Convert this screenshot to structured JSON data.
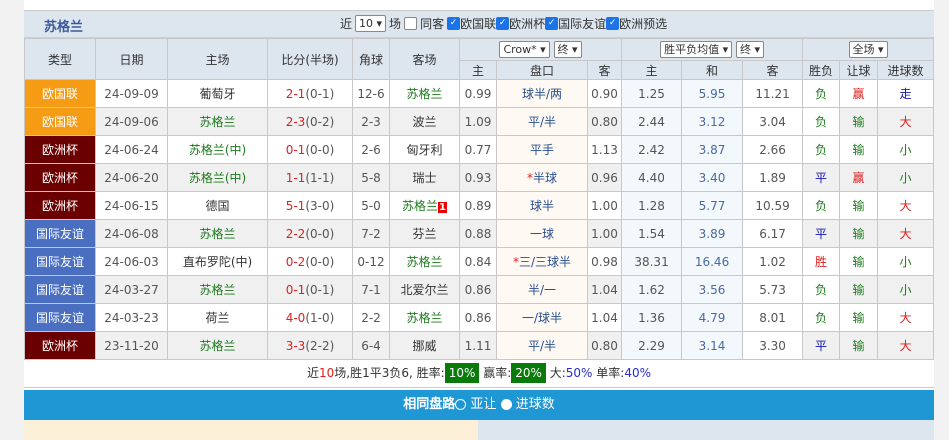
{
  "team": "苏格兰",
  "filters": {
    "near": "近",
    "count": "10",
    "unit": "场",
    "same_away": "同客",
    "same_away_checked": false,
    "leagues": [
      {
        "label": "欧国联",
        "checked": true
      },
      {
        "label": "欧洲杯",
        "checked": true
      },
      {
        "label": "国际友谊",
        "checked": true
      },
      {
        "label": "欧洲预选",
        "checked": true
      }
    ]
  },
  "headers": {
    "type": "类型",
    "date": "日期",
    "home": "主场",
    "score": "比分(半场)",
    "corner": "角球",
    "away": "客场",
    "company": "Crow*",
    "phase1": "终",
    "odds_type": "胜平负均值",
    "phase2": "终",
    "scope": "全场",
    "ah_home": "主",
    "ah_line": "盘口",
    "ah_away": "客",
    "eu_home": "主",
    "eu_draw": "和",
    "eu_away": "客",
    "wl": "胜负",
    "ah_res": "让球",
    "ou_res": "进球数"
  },
  "colors": {
    "欧国联": "#f59b14",
    "欧洲杯": "#6b0000",
    "国际友谊": "#4a6fc1"
  },
  "rows": [
    {
      "type": "欧国联",
      "date": "24-09-09",
      "home": "葡萄牙",
      "home_green": false,
      "ft": "2-1",
      "ht": "(0-1)",
      "corner": "12-6",
      "away": "苏格兰",
      "away_green": true,
      "red_card": "",
      "ah1": "0.99",
      "line": "球半/两",
      "star": "",
      "ah2": "0.90",
      "e1": "1.25",
      "e2": "5.95",
      "e3": "11.21",
      "wl": "负",
      "ah": "赢",
      "ou": "走"
    },
    {
      "type": "欧国联",
      "date": "24-09-06",
      "home": "苏格兰",
      "home_green": true,
      "ft": "2-3",
      "ht": "(0-2)",
      "corner": "2-3",
      "away": "波兰",
      "away_green": false,
      "red_card": "",
      "ah1": "1.09",
      "line": "平/半",
      "star": "",
      "ah2": "0.80",
      "e1": "2.44",
      "e2": "3.12",
      "e3": "3.04",
      "wl": "负",
      "ah": "输",
      "ou": "大"
    },
    {
      "type": "欧洲杯",
      "date": "24-06-24",
      "home": "苏格兰(中)",
      "home_green": true,
      "ft": "0-1",
      "ht": "(0-0)",
      "corner": "2-6",
      "away": "匈牙利",
      "away_green": false,
      "red_card": "",
      "ah1": "0.77",
      "line": "平手",
      "star": "",
      "ah2": "1.13",
      "e1": "2.42",
      "e2": "3.87",
      "e3": "2.66",
      "wl": "负",
      "ah": "输",
      "ou": "小"
    },
    {
      "type": "欧洲杯",
      "date": "24-06-20",
      "home": "苏格兰(中)",
      "home_green": true,
      "ft": "1-1",
      "ht": "(1-1)",
      "corner": "5-8",
      "away": "瑞士",
      "away_green": false,
      "red_card": "",
      "ah1": "0.93",
      "line": "半球",
      "star": "*",
      "ah2": "0.96",
      "e1": "4.40",
      "e2": "3.40",
      "e3": "1.89",
      "wl": "平",
      "ah": "赢",
      "ou": "小"
    },
    {
      "type": "欧洲杯",
      "date": "24-06-15",
      "home": "德国",
      "home_green": false,
      "ft": "5-1",
      "ht": "(3-0)",
      "corner": "5-0",
      "away": "苏格兰",
      "away_green": true,
      "red_card": "1",
      "ah1": "0.89",
      "line": "球半",
      "star": "",
      "ah2": "1.00",
      "e1": "1.28",
      "e2": "5.77",
      "e3": "10.59",
      "wl": "负",
      "ah": "输",
      "ou": "大"
    },
    {
      "type": "国际友谊",
      "date": "24-06-08",
      "home": "苏格兰",
      "home_green": true,
      "ft": "2-2",
      "ht": "(0-0)",
      "corner": "7-2",
      "away": "芬兰",
      "away_green": false,
      "red_card": "",
      "ah1": "0.88",
      "line": "一球",
      "star": "",
      "ah2": "1.00",
      "e1": "1.54",
      "e2": "3.89",
      "e3": "6.17",
      "wl": "平",
      "ah": "输",
      "ou": "大"
    },
    {
      "type": "国际友谊",
      "date": "24-06-03",
      "home": "直布罗陀(中)",
      "home_green": false,
      "ft": "0-2",
      "ht": "(0-0)",
      "corner": "0-12",
      "away": "苏格兰",
      "away_green": true,
      "red_card": "",
      "ah1": "0.84",
      "line": "三/三球半",
      "star": "*",
      "ah2": "0.98",
      "e1": "38.31",
      "e2": "16.46",
      "e3": "1.02",
      "wl": "胜",
      "ah": "输",
      "ou": "小"
    },
    {
      "type": "国际友谊",
      "date": "24-03-27",
      "home": "苏格兰",
      "home_green": true,
      "ft": "0-1",
      "ht": "(0-1)",
      "corner": "7-1",
      "away": "北爱尔兰",
      "away_green": false,
      "red_card": "",
      "ah1": "0.86",
      "line": "半/一",
      "star": "",
      "ah2": "1.04",
      "e1": "1.62",
      "e2": "3.56",
      "e3": "5.73",
      "wl": "负",
      "ah": "输",
      "ou": "小"
    },
    {
      "type": "国际友谊",
      "date": "24-03-23",
      "home": "荷兰",
      "home_green": false,
      "ft": "4-0",
      "ht": "(1-0)",
      "corner": "2-2",
      "away": "苏格兰",
      "away_green": true,
      "red_card": "",
      "ah1": "0.86",
      "line": "一/球半",
      "star": "",
      "ah2": "1.04",
      "e1": "1.36",
      "e2": "4.79",
      "e3": "8.01",
      "wl": "负",
      "ah": "输",
      "ou": "大"
    },
    {
      "type": "欧洲杯",
      "date": "23-11-20",
      "home": "苏格兰",
      "home_green": true,
      "ft": "3-3",
      "ht": "(2-2)",
      "corner": "6-4",
      "away": "挪威",
      "away_green": false,
      "red_card": "",
      "ah1": "1.11",
      "line": "平/半",
      "star": "",
      "ah2": "0.80",
      "e1": "2.29",
      "e2": "3.14",
      "e3": "3.30",
      "wl": "平",
      "ah": "输",
      "ou": "大"
    }
  ],
  "summary": {
    "p1": "近",
    "n": "10",
    "p2": "场,胜1平3负6, 胜率:",
    "win_rate": "10%",
    "p3": "赢率:",
    "ah_rate": "20%",
    "p4": "大:",
    "over": "50%",
    "p5": "单率:",
    "odd": "40%"
  },
  "bar": {
    "title": "相同盘路",
    "opt1": "亚让",
    "opt2": "进球数"
  }
}
